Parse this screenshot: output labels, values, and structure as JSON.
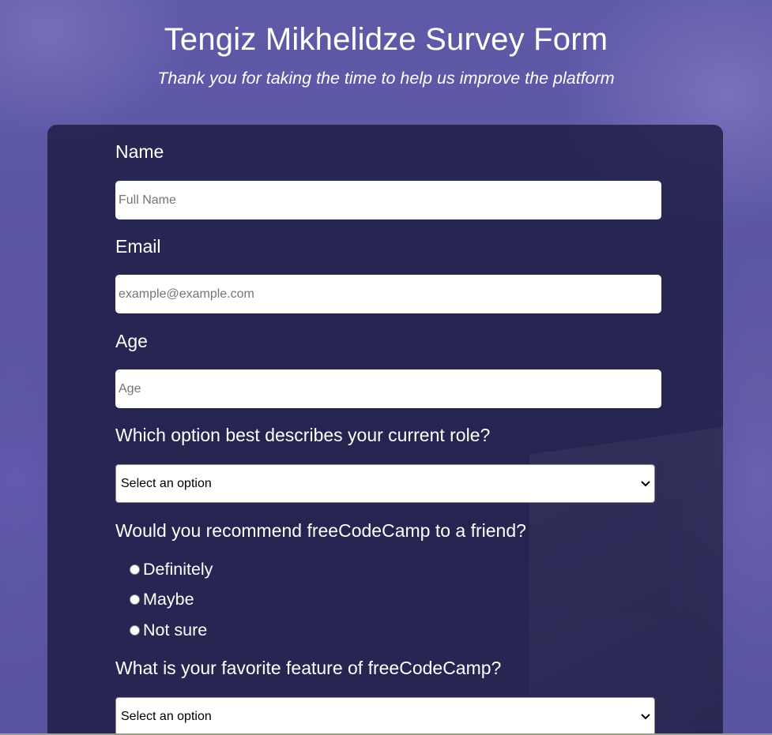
{
  "header": {
    "title": "Tengiz Mikhelidze Survey Form",
    "subtitle": "Thank you for taking the time to help us improve the platform"
  },
  "form": {
    "name": {
      "label": "Name",
      "value": "",
      "placeholder": "Full Name"
    },
    "email": {
      "label": "Email",
      "value": "",
      "placeholder": "example@example.com"
    },
    "age": {
      "label": "Age",
      "value": "",
      "placeholder": "Age"
    },
    "role": {
      "label": "Which option best describes your current role?",
      "selected": "Select an option"
    },
    "recommend": {
      "label": "Would you recommend freeCodeCamp to a friend?",
      "options": [
        {
          "label": "Definitely",
          "checked": false
        },
        {
          "label": "Maybe",
          "checked": false
        },
        {
          "label": "Not sure",
          "checked": false
        }
      ]
    },
    "feature": {
      "label": "What is your favorite feature of freeCodeCamp?",
      "selected": "Select an option"
    }
  },
  "icons": {
    "select_arrow": "chevron-down-icon",
    "radio": "radio-unchecked"
  },
  "colors": {
    "background": "#5a55a0",
    "card": "#1c1a3e",
    "text": "#ffffff",
    "input_bg": "#ffffff",
    "placeholder": "#757575"
  }
}
